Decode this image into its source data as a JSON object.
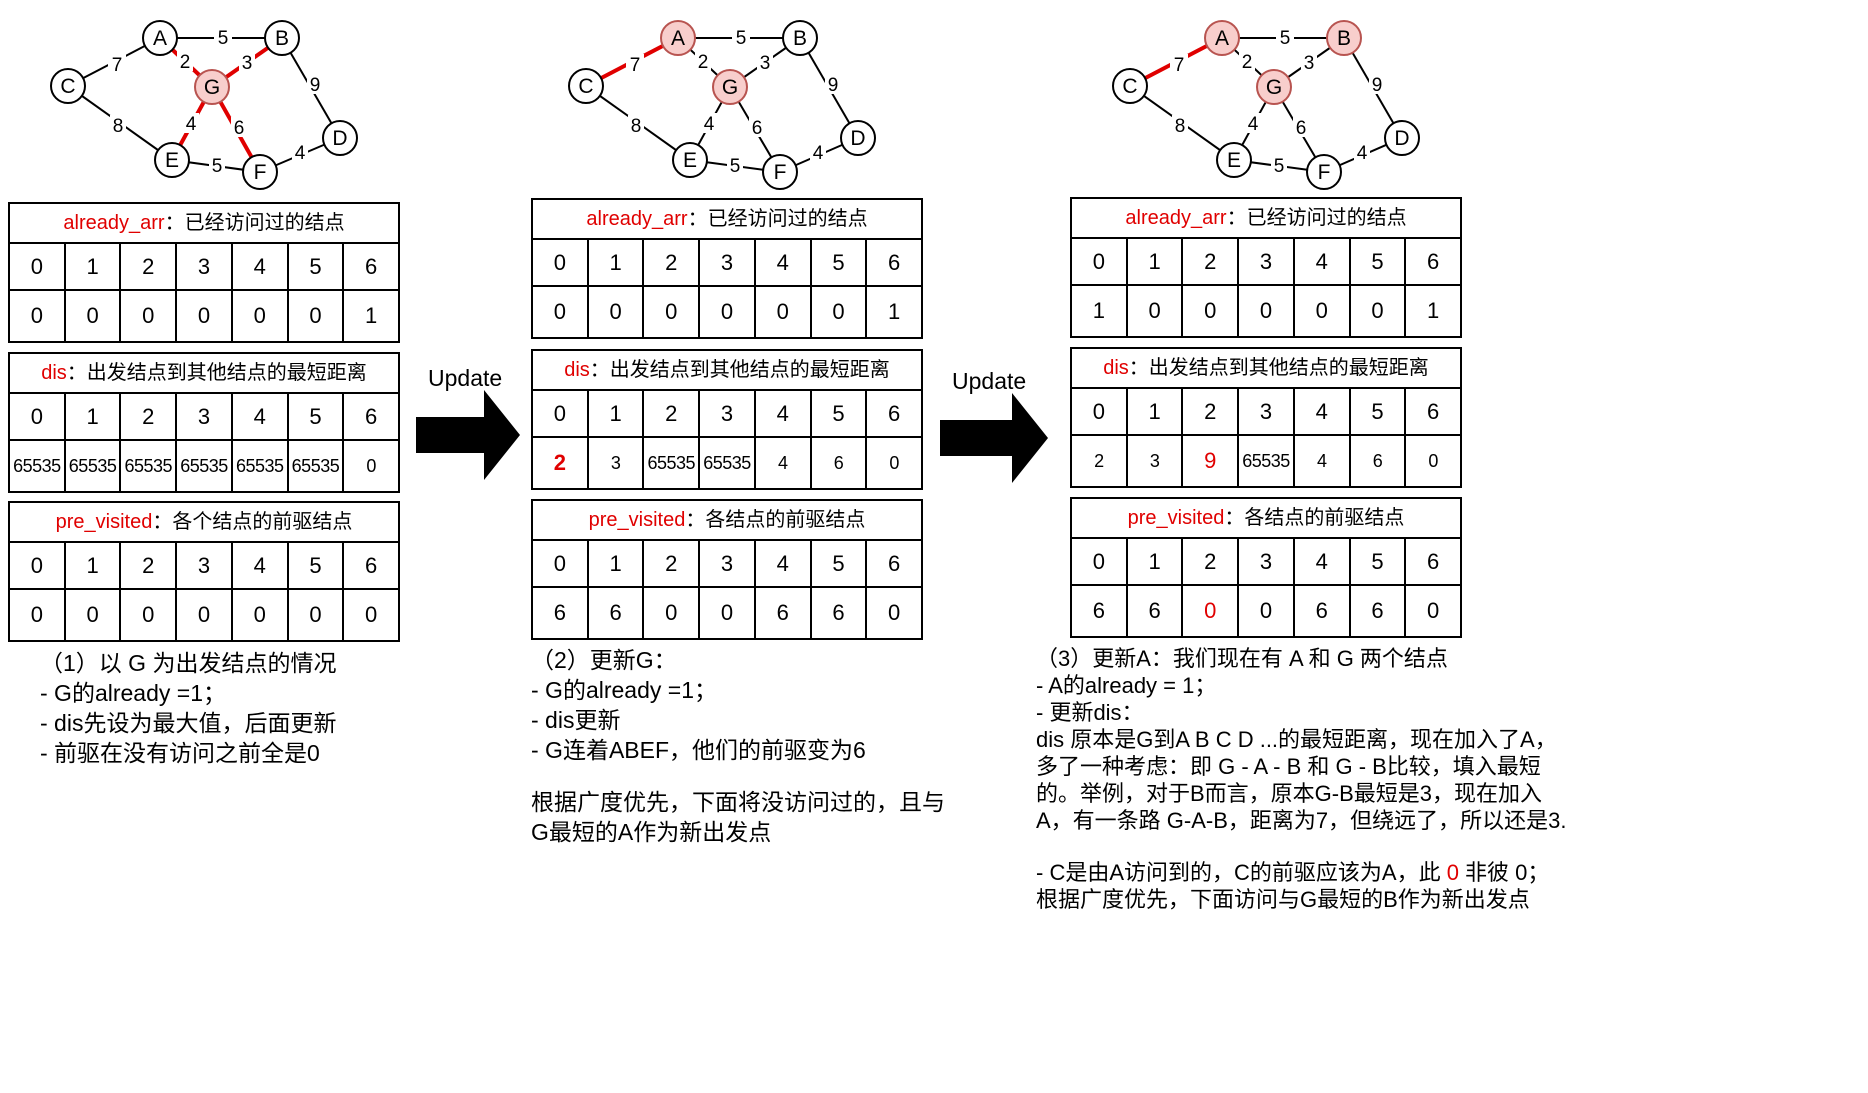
{
  "labels": {
    "already_name": "already_arr",
    "already_desc": "：已经访问过的结点",
    "dis_name": "dis",
    "dis_desc": "：出发结点到其他结点的最短距离",
    "pre_name": "pre_visited",
    "pre_desc_1": "：各个结点的前驱结点",
    "pre_desc_2": "：各结点的前驱结点",
    "update": "Update"
  },
  "indices": [
    "0",
    "1",
    "2",
    "3",
    "4",
    "5",
    "6"
  ],
  "graph": {
    "nodes": [
      "A",
      "B",
      "C",
      "D",
      "E",
      "F",
      "G"
    ],
    "edge_weights": {
      "AB": "5",
      "AC": "7",
      "AG": "2",
      "BG": "3",
      "BD": "9",
      "CE": "8",
      "EG": "4",
      "FG": "6",
      "EF": "5",
      "DF": "4"
    }
  },
  "panel1": {
    "already": [
      "0",
      "0",
      "0",
      "0",
      "0",
      "0",
      "1"
    ],
    "dis": [
      "65535",
      "65535",
      "65535",
      "65535",
      "65535",
      "65535",
      "0"
    ],
    "pre": [
      "0",
      "0",
      "0",
      "0",
      "0",
      "0",
      "0"
    ],
    "desc": {
      "line1": "（1）以 G 为出发结点的情况",
      "line2": "- G的already =1；",
      "line3": "- dis先设为最大值，后面更新",
      "line4": "- 前驱在没有访问之前全是0"
    }
  },
  "panel2": {
    "already": [
      "0",
      "0",
      "0",
      "0",
      "0",
      "0",
      "1"
    ],
    "dis": [
      "2",
      "3",
      "65535",
      "65535",
      "4",
      "6",
      "0"
    ],
    "pre": [
      "6",
      "6",
      "0",
      "0",
      "6",
      "6",
      "0"
    ],
    "desc": {
      "line1": "（2）更新G：",
      "line2": "- G的already =1；",
      "line3": "- dis更新",
      "line4": "- G连着ABEF，他们的前驱变为6",
      "line5": "根据广度优先，下面将没访问过的，且与",
      "line6": "G最短的A作为新出发点"
    }
  },
  "panel3": {
    "already": [
      "1",
      "0",
      "0",
      "0",
      "0",
      "0",
      "1"
    ],
    "dis": [
      "2",
      "3",
      "9",
      "65535",
      "4",
      "6",
      "0"
    ],
    "pre": [
      "6",
      "6",
      "0",
      "0",
      "6",
      "6",
      "0"
    ],
    "desc": {
      "line1": "（3）更新A：我们现在有 A 和 G 两个结点",
      "line2": "- A的already = 1；",
      "line3": "- 更新dis：",
      "line4": "dis 原本是G到A B C D ...的最短距离，现在加入了A，",
      "line5": "多了一种考虑：即 G - A - B 和 G - B比较，填入最短",
      "line6": "的。举例，对于B而言，原本G-B最短是3，现在加入",
      "line7": "A，有一条路 G-A-B，距离为7，但绕远了，所以还是3.",
      "line8a": "- C是由A访问到的，C的前驱应该为A，此 ",
      "line8b": "0",
      "line8c": " 非彼 0；",
      "line9": "根据广度优先，下面访问与G最短的B作为新出发点"
    }
  },
  "colors": {
    "highlight_red": "#e00000",
    "node_fill": "#f8cecc",
    "node_stroke": "#b85450"
  }
}
